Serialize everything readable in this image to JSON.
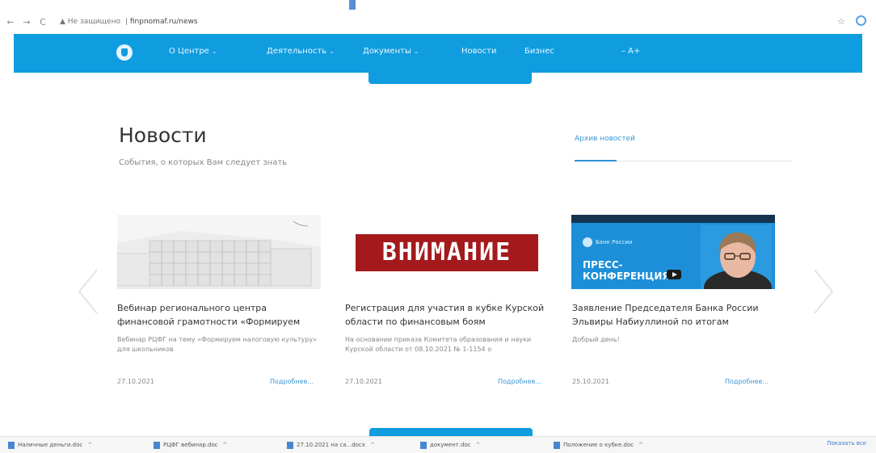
{
  "browser": {
    "back_icon": "←",
    "forward_icon": "→",
    "reload_icon": "C",
    "security_label": "▲ Не защищено",
    "url_host": "finpnomaf.ru/news",
    "star_icon": "☆"
  },
  "site_nav": {
    "items": [
      {
        "label": "О Центре",
        "caret": "⌄"
      },
      {
        "label": "Деятельность",
        "caret": "⌄"
      },
      {
        "label": "Документы",
        "caret": "⌄"
      },
      {
        "label": "Новости",
        "caret": ""
      },
      {
        "label": "Бизнес",
        "caret": ""
      }
    ],
    "font_toggle": "– A+"
  },
  "news": {
    "title": "Новости",
    "subtitle": "События, о которых Вам следует знать",
    "archive_label": "Архив новостей"
  },
  "cards": [
    {
      "title": "Вебинар регионального центра финансовой грамотности «Формируем",
      "text": "Вебинар РЦФГ на тему «Формируем налоговую культуру» для школьников",
      "date": "27.10.2021",
      "more": "Подробнее..."
    },
    {
      "image_text": "ВНИМАНИЕ",
      "title": "Регистрация для участия в кубке Курской области по финансовым боям",
      "text": "На основании приказа Комитета образования и науки Курской области от 08.10.2021 № 1-1154 о",
      "date": "27.10.2021",
      "more": "Подробнее..."
    },
    {
      "image_brand": "Банк России",
      "image_press": "ПРЕСС-\nКОНФЕРЕНЦИЯ",
      "title": "Заявление Председателя Банка России Эльвиры Набиуллиной по итогам",
      "text": "Добрый день!",
      "date": "25.10.2021",
      "more": "Подробнее..."
    }
  ],
  "downloads": {
    "items": [
      {
        "label": "Наличные деньги.doc"
      },
      {
        "label": "РЦФГ вебинар.doc"
      },
      {
        "label": "27.10.2021 на са...docx"
      },
      {
        "label": "документ.doc"
      },
      {
        "label": "Положение о кубке.doc"
      }
    ],
    "show_all": "Показать все"
  },
  "colors": {
    "header": "#0f9de0",
    "accent_link": "#3a96d6",
    "banner_red": "#a41a1c"
  }
}
